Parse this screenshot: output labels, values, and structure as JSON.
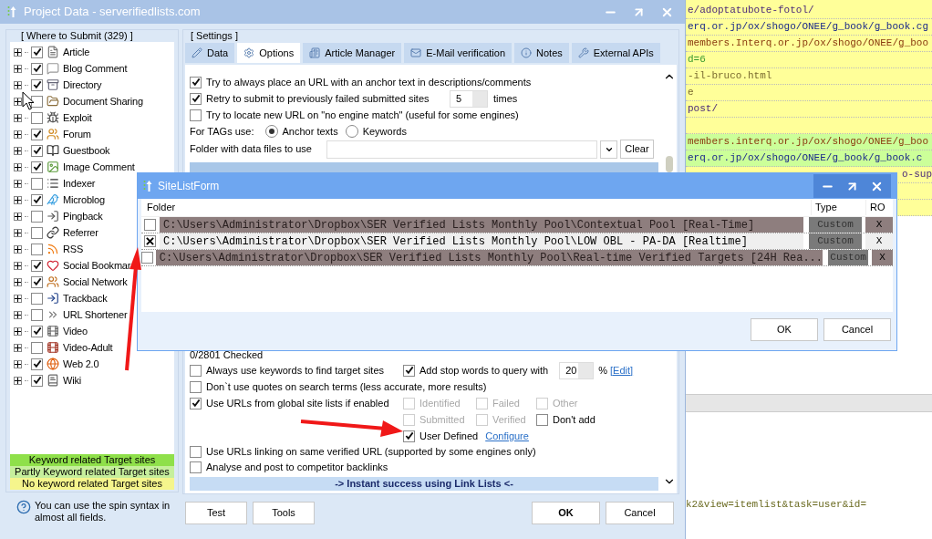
{
  "window": {
    "title": "Project Data - serverifiedlists.com"
  },
  "where_to_submit": {
    "title": "[ Where to Submit  (329) ]",
    "items": [
      {
        "label": "Article",
        "checked": true
      },
      {
        "label": "Blog Comment",
        "checked": true
      },
      {
        "label": "Directory",
        "checked": true
      },
      {
        "label": "Document Sharing",
        "checked": false
      },
      {
        "label": "Exploit",
        "checked": false
      },
      {
        "label": "Forum",
        "checked": true
      },
      {
        "label": "Guestbook",
        "checked": true
      },
      {
        "label": "Image Comment",
        "checked": true
      },
      {
        "label": "Indexer",
        "checked": false
      },
      {
        "label": "Microblog",
        "checked": true
      },
      {
        "label": "Pingback",
        "checked": false
      },
      {
        "label": "Referrer",
        "checked": false
      },
      {
        "label": "RSS",
        "checked": false
      },
      {
        "label": "Social Bookmar",
        "checked": true
      },
      {
        "label": "Social Network",
        "checked": true
      },
      {
        "label": "Trackback",
        "checked": false
      },
      {
        "label": "URL Shortener",
        "checked": false
      },
      {
        "label": "Video",
        "checked": true
      },
      {
        "label": "Video-Adult",
        "checked": false
      },
      {
        "label": "Web 2.0",
        "checked": true
      },
      {
        "label": "Wiki",
        "checked": true
      }
    ]
  },
  "legend": [
    {
      "label": "Keyword related Target sites",
      "color": "#8fe04a"
    },
    {
      "label": "Partly Keyword related Target sites",
      "color": "#c6ef9c"
    },
    {
      "label": "No keyword related Target sites",
      "color": "#f5f58c"
    }
  ],
  "hint": "You can use the spin syntax in almost all fields.",
  "settings": {
    "title": "[ Settings ]",
    "tabs": [
      {
        "label": "Data",
        "selected": false
      },
      {
        "label": "Options",
        "selected": true
      },
      {
        "label": "Article Manager",
        "selected": false
      },
      {
        "label": "E-Mail verification",
        "selected": false
      },
      {
        "label": "Notes",
        "selected": false
      },
      {
        "label": "External APIs",
        "selected": false
      }
    ],
    "top_options": [
      {
        "kind": "checkbox",
        "label": "Try to always place an URL with an anchor text in descriptions/comments",
        "checked": true
      },
      {
        "kind": "number",
        "label": "Retry to submit to previously failed submitted sites",
        "checked": true,
        "value": "5",
        "unit": "times"
      },
      {
        "kind": "checkbox",
        "label": "Try to locate new URL on \"no engine match\" (useful for some engines)",
        "checked": false
      }
    ],
    "tags": {
      "label": "For TAGs use:",
      "options": [
        {
          "label": "Anchor texts",
          "selected": true
        },
        {
          "label": "Keywords",
          "selected": false
        }
      ]
    },
    "folder": {
      "label": "Folder with data files to use",
      "button": "Clear"
    },
    "checked_count": "0/2801 Checked",
    "search_options": [
      {
        "label": "Always use keywords to find target sites",
        "checked": false
      },
      {
        "label": "Don`t use quotes on search terms (less accurate, more results)",
        "checked": false
      },
      {
        "label": "Use URLs from global site lists if enabled",
        "checked": true
      },
      {
        "label": "Use URLs linking on same verified URL (supported by some engines only)",
        "checked": false
      },
      {
        "label": "Analyse and post to competitor backlinks",
        "checked": false
      }
    ],
    "stop_words": {
      "label": "Add stop words to query with",
      "checked": true,
      "value": "20",
      "unit": "%",
      "link": "[Edit]"
    },
    "site_lists": [
      {
        "label": "Identified",
        "checked": false,
        "disabled": true
      },
      {
        "label": "Failed",
        "checked": false,
        "disabled": true
      },
      {
        "label": "Other",
        "checked": false,
        "disabled": true
      },
      {
        "label": "Submitted",
        "checked": false,
        "disabled": true
      },
      {
        "label": "Verified",
        "checked": false,
        "disabled": true
      },
      {
        "label": "Don't add",
        "checked": false,
        "disabled": false
      }
    ],
    "user_defined": {
      "label": "User Defined",
      "checked": true,
      "link": "Configure"
    },
    "banner": "-> Instant success using Link Lists <-",
    "buttons": [
      {
        "label": "Test",
        "default": false
      },
      {
        "label": "Tools",
        "default": false
      },
      {
        "label": "OK",
        "default": true
      },
      {
        "label": "Cancel",
        "default": false
      }
    ]
  },
  "dialog": {
    "title": "SiteListForm",
    "columns": [
      "Folder",
      "Type",
      "RO"
    ],
    "rows": [
      {
        "checked": false,
        "folder": "C:\\Users\\Administrator\\Dropbox\\SER Verified Lists Monthly Pool\\Contextual Pool [Real-Time]",
        "type": "Custom",
        "ro": "X",
        "selected": false
      },
      {
        "checked": true,
        "folder": "C:\\Users\\Administrator\\Dropbox\\SER Verified Lists Monthly Pool\\LOW OBL - PA-DA [Realtime]",
        "type": "Custom",
        "ro": "X",
        "selected": true
      },
      {
        "checked": false,
        "folder": "C:\\Users\\Administrator\\Dropbox\\SER Verified Lists Monthly Pool\\Real-time Verified Targets [24H Rea...",
        "type": "Custom",
        "ro": "X",
        "selected": false
      }
    ],
    "buttons": [
      "OK",
      "Cancel"
    ]
  },
  "background_list": {
    "rows": [
      {
        "text": "e/adoptatubote-fotol/",
        "color": "#ffff99"
      },
      {
        "text": "erq.or.jp/ox/shogo/ONEE/g_book/g_book.cg",
        "color": "#ffff99"
      },
      {
        "text": "members.Interq.or.jp/ox/shogo/ONEE/g_boo",
        "color": "#ffff99"
      },
      {
        "text": "d=6",
        "color": "#ffff99"
      },
      {
        "text": "-il-bruco.html",
        "color": "#ffff99"
      },
      {
        "text": "e",
        "color": "#ffff99"
      },
      {
        "text": "post/",
        "color": "#ffff99"
      },
      {
        "color": "#ffff99"
      },
      {
        "text": "members.interq.or.jp/ox/shogo/ONEE/g_boo",
        "color": "#ccff99"
      },
      {
        "text": "erq.or.jp/ox/shogo/ONEE/g_book/g_book.c",
        "color": "#ccff99"
      },
      {
        "text": "o-sup",
        "color": "#ffff99"
      },
      {
        "color": "#ffff99"
      },
      {
        "color": "#ffff99"
      }
    ],
    "footer": "k2&view=itemlist&task=user&id="
  }
}
